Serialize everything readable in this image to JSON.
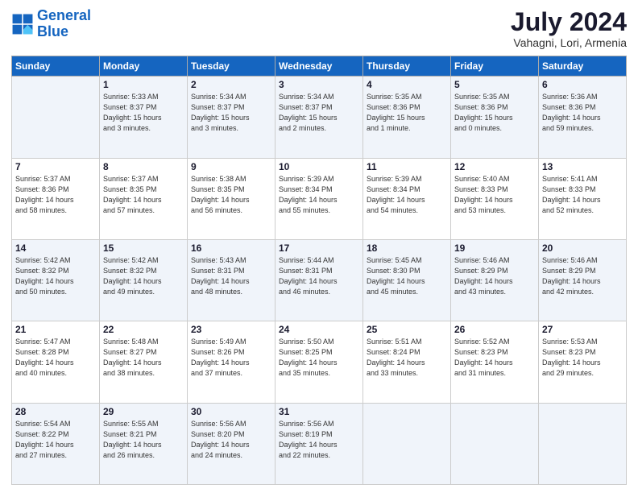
{
  "logo": {
    "text_general": "General",
    "text_blue": "Blue"
  },
  "header": {
    "month": "July 2024",
    "location": "Vahagni, Lori, Armenia"
  },
  "weekdays": [
    "Sunday",
    "Monday",
    "Tuesday",
    "Wednesday",
    "Thursday",
    "Friday",
    "Saturday"
  ],
  "weeks": [
    [
      {
        "day": "",
        "info": ""
      },
      {
        "day": "1",
        "info": "Sunrise: 5:33 AM\nSunset: 8:37 PM\nDaylight: 15 hours\nand 3 minutes."
      },
      {
        "day": "2",
        "info": "Sunrise: 5:34 AM\nSunset: 8:37 PM\nDaylight: 15 hours\nand 3 minutes."
      },
      {
        "day": "3",
        "info": "Sunrise: 5:34 AM\nSunset: 8:37 PM\nDaylight: 15 hours\nand 2 minutes."
      },
      {
        "day": "4",
        "info": "Sunrise: 5:35 AM\nSunset: 8:36 PM\nDaylight: 15 hours\nand 1 minute."
      },
      {
        "day": "5",
        "info": "Sunrise: 5:35 AM\nSunset: 8:36 PM\nDaylight: 15 hours\nand 0 minutes."
      },
      {
        "day": "6",
        "info": "Sunrise: 5:36 AM\nSunset: 8:36 PM\nDaylight: 14 hours\nand 59 minutes."
      }
    ],
    [
      {
        "day": "7",
        "info": "Sunrise: 5:37 AM\nSunset: 8:36 PM\nDaylight: 14 hours\nand 58 minutes."
      },
      {
        "day": "8",
        "info": "Sunrise: 5:37 AM\nSunset: 8:35 PM\nDaylight: 14 hours\nand 57 minutes."
      },
      {
        "day": "9",
        "info": "Sunrise: 5:38 AM\nSunset: 8:35 PM\nDaylight: 14 hours\nand 56 minutes."
      },
      {
        "day": "10",
        "info": "Sunrise: 5:39 AM\nSunset: 8:34 PM\nDaylight: 14 hours\nand 55 minutes."
      },
      {
        "day": "11",
        "info": "Sunrise: 5:39 AM\nSunset: 8:34 PM\nDaylight: 14 hours\nand 54 minutes."
      },
      {
        "day": "12",
        "info": "Sunrise: 5:40 AM\nSunset: 8:33 PM\nDaylight: 14 hours\nand 53 minutes."
      },
      {
        "day": "13",
        "info": "Sunrise: 5:41 AM\nSunset: 8:33 PM\nDaylight: 14 hours\nand 52 minutes."
      }
    ],
    [
      {
        "day": "14",
        "info": "Sunrise: 5:42 AM\nSunset: 8:32 PM\nDaylight: 14 hours\nand 50 minutes."
      },
      {
        "day": "15",
        "info": "Sunrise: 5:42 AM\nSunset: 8:32 PM\nDaylight: 14 hours\nand 49 minutes."
      },
      {
        "day": "16",
        "info": "Sunrise: 5:43 AM\nSunset: 8:31 PM\nDaylight: 14 hours\nand 48 minutes."
      },
      {
        "day": "17",
        "info": "Sunrise: 5:44 AM\nSunset: 8:31 PM\nDaylight: 14 hours\nand 46 minutes."
      },
      {
        "day": "18",
        "info": "Sunrise: 5:45 AM\nSunset: 8:30 PM\nDaylight: 14 hours\nand 45 minutes."
      },
      {
        "day": "19",
        "info": "Sunrise: 5:46 AM\nSunset: 8:29 PM\nDaylight: 14 hours\nand 43 minutes."
      },
      {
        "day": "20",
        "info": "Sunrise: 5:46 AM\nSunset: 8:29 PM\nDaylight: 14 hours\nand 42 minutes."
      }
    ],
    [
      {
        "day": "21",
        "info": "Sunrise: 5:47 AM\nSunset: 8:28 PM\nDaylight: 14 hours\nand 40 minutes."
      },
      {
        "day": "22",
        "info": "Sunrise: 5:48 AM\nSunset: 8:27 PM\nDaylight: 14 hours\nand 38 minutes."
      },
      {
        "day": "23",
        "info": "Sunrise: 5:49 AM\nSunset: 8:26 PM\nDaylight: 14 hours\nand 37 minutes."
      },
      {
        "day": "24",
        "info": "Sunrise: 5:50 AM\nSunset: 8:25 PM\nDaylight: 14 hours\nand 35 minutes."
      },
      {
        "day": "25",
        "info": "Sunrise: 5:51 AM\nSunset: 8:24 PM\nDaylight: 14 hours\nand 33 minutes."
      },
      {
        "day": "26",
        "info": "Sunrise: 5:52 AM\nSunset: 8:23 PM\nDaylight: 14 hours\nand 31 minutes."
      },
      {
        "day": "27",
        "info": "Sunrise: 5:53 AM\nSunset: 8:23 PM\nDaylight: 14 hours\nand 29 minutes."
      }
    ],
    [
      {
        "day": "28",
        "info": "Sunrise: 5:54 AM\nSunset: 8:22 PM\nDaylight: 14 hours\nand 27 minutes."
      },
      {
        "day": "29",
        "info": "Sunrise: 5:55 AM\nSunset: 8:21 PM\nDaylight: 14 hours\nand 26 minutes."
      },
      {
        "day": "30",
        "info": "Sunrise: 5:56 AM\nSunset: 8:20 PM\nDaylight: 14 hours\nand 24 minutes."
      },
      {
        "day": "31",
        "info": "Sunrise: 5:56 AM\nSunset: 8:19 PM\nDaylight: 14 hours\nand 22 minutes."
      },
      {
        "day": "",
        "info": ""
      },
      {
        "day": "",
        "info": ""
      },
      {
        "day": "",
        "info": ""
      }
    ]
  ]
}
